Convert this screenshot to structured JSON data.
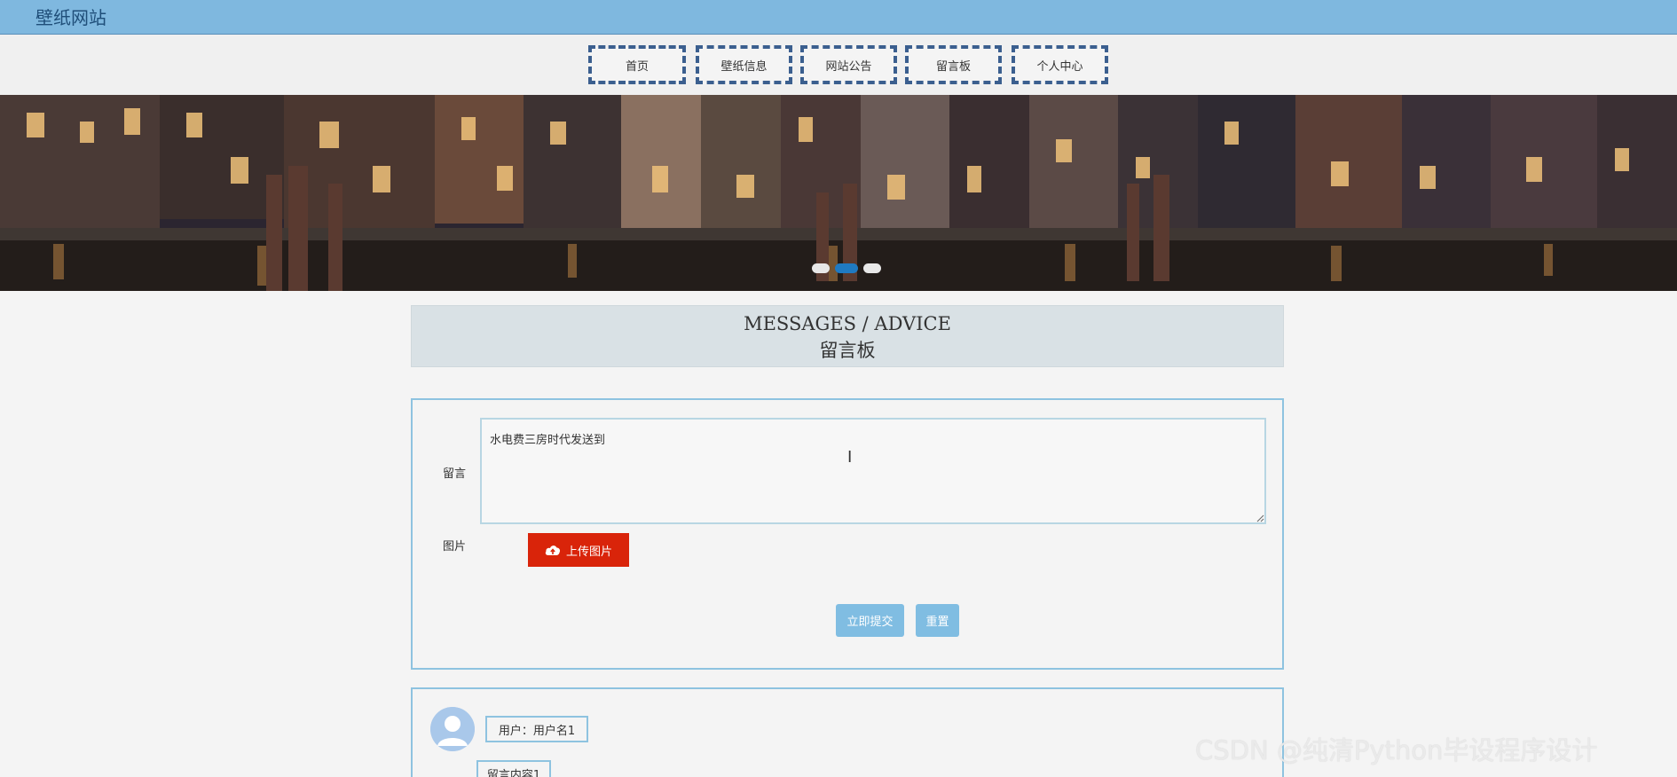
{
  "site": {
    "title": "壁纸网站"
  },
  "nav": {
    "items": [
      {
        "label": "首页"
      },
      {
        "label": "壁纸信息"
      },
      {
        "label": "网站公告"
      },
      {
        "label": "留言板"
      },
      {
        "label": "个人中心"
      }
    ]
  },
  "banner": {
    "slides": 3,
    "active_index": 1,
    "icon": "night-waterfront-city-photo"
  },
  "section": {
    "title_en": "MESSAGES / ADVICE",
    "title_cn": "留言板"
  },
  "form": {
    "message_label": "留言",
    "message_value": "水电费三房时代发送到",
    "image_label": "图片",
    "upload_label": "上传图片",
    "upload_icon": "cloud-upload-icon",
    "submit_label": "立即提交",
    "reset_label": "重置"
  },
  "comments": [
    {
      "user": "用户：用户名1",
      "content": "留言内容1"
    }
  ],
  "watermark": "CSDN @纯清Python毕设程序设计",
  "colors": {
    "topbar": "#7fb8df",
    "nav_border": "#3b5f8f",
    "accent_red": "#d9240a",
    "button_blue": "#80bde2",
    "card_border": "#8ec3e0"
  }
}
